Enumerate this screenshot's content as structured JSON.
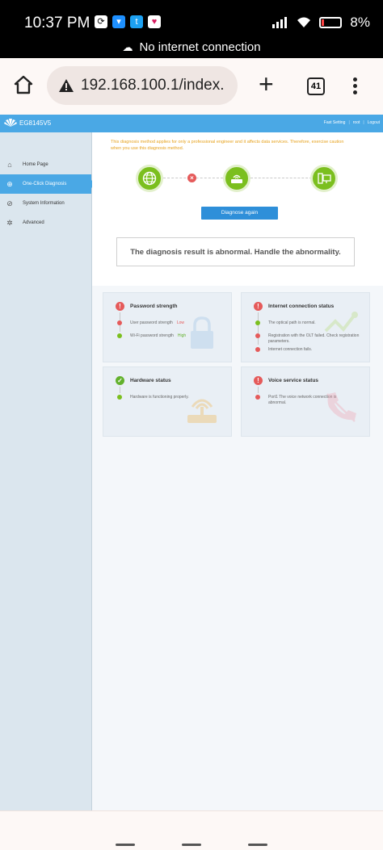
{
  "status_bar": {
    "time": "10:37 PM",
    "battery": "8%",
    "network_message": "No internet connection"
  },
  "browser": {
    "url": "192.168.100.1/index.",
    "tab_count": "41",
    "security": "not-secure"
  },
  "router": {
    "model": "EG8145V5",
    "nav_links": [
      "Fast Setting",
      "root",
      "Logout"
    ],
    "sidebar": [
      {
        "label": "Home Page",
        "icon": "home-icon",
        "active": false
      },
      {
        "label": "One-Click Diagnosis",
        "icon": "diagnosis-icon",
        "active": true
      },
      {
        "label": "System Information",
        "icon": "info-icon",
        "active": false
      },
      {
        "label": "Advanced",
        "icon": "gear-icon",
        "active": false
      }
    ],
    "notice": "This diagnosis method applies for only a professional engineer and it affects data services. Therefore, exercise caution when you use this diagnosis method.",
    "diagnose_button": "Diagnose again",
    "result": "The diagnosis result is abnormal. Handle the abnormality.",
    "cards": {
      "password": {
        "title": "Password strength",
        "status": "error",
        "rows": [
          {
            "label": "User password strength",
            "value": "Low"
          },
          {
            "label": "Wi-Fi password strength",
            "value": "High"
          }
        ]
      },
      "internet": {
        "title": "Internet connection status",
        "status": "error",
        "rows": [
          {
            "label": "The optical path is normal."
          },
          {
            "label": "Registration with the OLT failed. Check registration parameters."
          },
          {
            "label": "Internet connection fails."
          }
        ]
      },
      "hardware": {
        "title": "Hardware status",
        "status": "ok",
        "rows": [
          {
            "label": "Hardware is functioning properly."
          }
        ]
      },
      "voice": {
        "title": "Voice service status",
        "status": "error",
        "rows": [
          {
            "label": "Port1 The voice network connection is abnormal."
          }
        ]
      }
    }
  },
  "colors": {
    "brand_blue": "#4aa8e5",
    "warning_orange": "#e6a21e",
    "ok_green": "#7bbf1e",
    "error_red": "#e55a5a"
  }
}
